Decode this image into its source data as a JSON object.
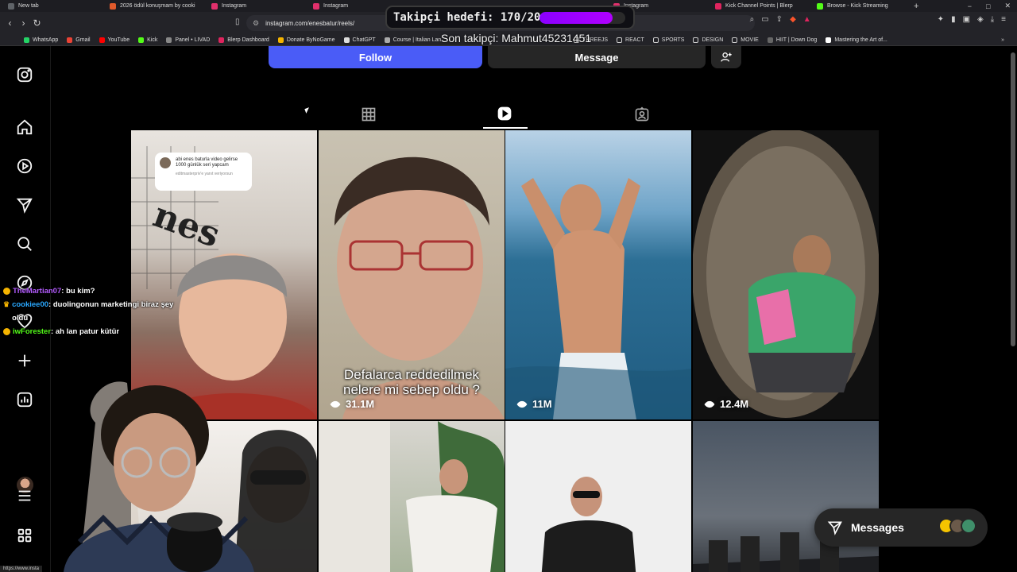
{
  "browser": {
    "tabs": [
      {
        "label": "New tab",
        "color": "#5f6368"
      },
      {
        "label": "2026 ödül konuşmam by cooki",
        "color": "#e05a2b"
      },
      {
        "label": "Instagram",
        "color": "#e1306c"
      },
      {
        "label": "Instagram",
        "color": "#e1306c"
      },
      {
        "label": "Instagram",
        "color": "#e1306c"
      },
      {
        "label": "Kick Channel Points | Blerp",
        "color": "#e0245e"
      },
      {
        "label": "Browse - Kick Streaming",
        "color": "#53fc18"
      }
    ],
    "new_tab": "+",
    "url": "instagram.com/enesbatur/reels/",
    "bookmarks": [
      "WhatsApp",
      "Gmail",
      "YouTube",
      "Kick",
      "Panel • LIVAD",
      "Blerp Dashboard",
      "Donate ByNoGame",
      "ChatGPT",
      "Course | Italian Lan...",
      "THREEJS",
      "REACT",
      "SPORTS",
      "DESIGN",
      "MOVIE",
      "HIIT | Down Dog",
      "Mastering the Art of..."
    ],
    "status_url": "https://www.insta"
  },
  "overlay": {
    "goal_label": "Takipçi hedefi: 170/200",
    "goal_progress": 0.85,
    "last_follower": "Son takipçi: Mahmut45231451"
  },
  "profile": {
    "follow_label": "Follow",
    "message_label": "Message"
  },
  "rail": {
    "icons": [
      "instagram-logo-icon",
      "home-icon",
      "reels-icon",
      "send-icon",
      "search-icon",
      "explore-icon",
      "heart-icon",
      "create-icon",
      "dashboard-icon",
      "profile-avatar",
      "menu-icon",
      "more-apps-icon"
    ]
  },
  "reels": [
    {
      "views": "",
      "caption": "",
      "comment_text": "abi enes baturla video gelirse 1000 günlük seri yapcam",
      "comment_sub": "editmasterpriv'e yanıt veriyorsun"
    },
    {
      "views": "31.1M",
      "caption": "Defalarca reddedilmek nelere mi sebep oldu ?"
    },
    {
      "views": "11M",
      "caption": ""
    },
    {
      "views": "12.4M",
      "caption": ""
    }
  ],
  "chat": [
    {
      "user": "TheMartian07",
      "color": "#b45cff",
      "message": "bu kim?"
    },
    {
      "user": "cookiee00",
      "color": "#29a8ff",
      "message": "duolingonun marketingi biraz şey oldu"
    },
    {
      "user": "iwForester",
      "color": "#53fc18",
      "message": "ah lan patur kütür"
    }
  ],
  "messages": {
    "label": "Messages"
  }
}
